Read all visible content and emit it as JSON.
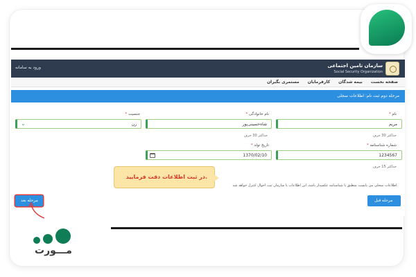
{
  "brand": {
    "accent": "#1a9e69",
    "word": "مـــورت"
  },
  "site": {
    "login_link": "ورود به سامانه",
    "org_name": "سازمان تامین اجتماعی",
    "org_name_en": "Social Security Organization",
    "nav": [
      "صفحه نخست",
      "بیمه شدگان",
      "کارفرمایان",
      "مستمری بگیران"
    ],
    "step_title": "مرحله دوم ثبت نام: اطلاعات سجلی"
  },
  "form": {
    "first_name": {
      "label": "نام",
      "value": "مریم",
      "hint": "حداکثر 30 حرف"
    },
    "last_name": {
      "label": "نام خانوادگی",
      "value": "شاه‌حسینی‌پور",
      "hint": "حداکثر 30 حرف"
    },
    "gender": {
      "label": "جنسیت",
      "value": "زن"
    },
    "id_number": {
      "label": "شماره شناسنامه",
      "value": "1234567",
      "hint": "حداکثر 15 حرف"
    },
    "birth_date": {
      "label": "تاریخ تولد",
      "value": "1370/02/10"
    },
    "info_text": "اطلاعات سجلی می بایست منطبق با شناسنامه عکسدار باشد، این اطلاعات با سازمان ثبت احوال کنترل خواهد شد."
  },
  "buttons": {
    "next": "مرحله بعد",
    "prev": "مرحله قبل"
  },
  "tooltip": "در ثبت اطلاعات دقت فرمایید."
}
